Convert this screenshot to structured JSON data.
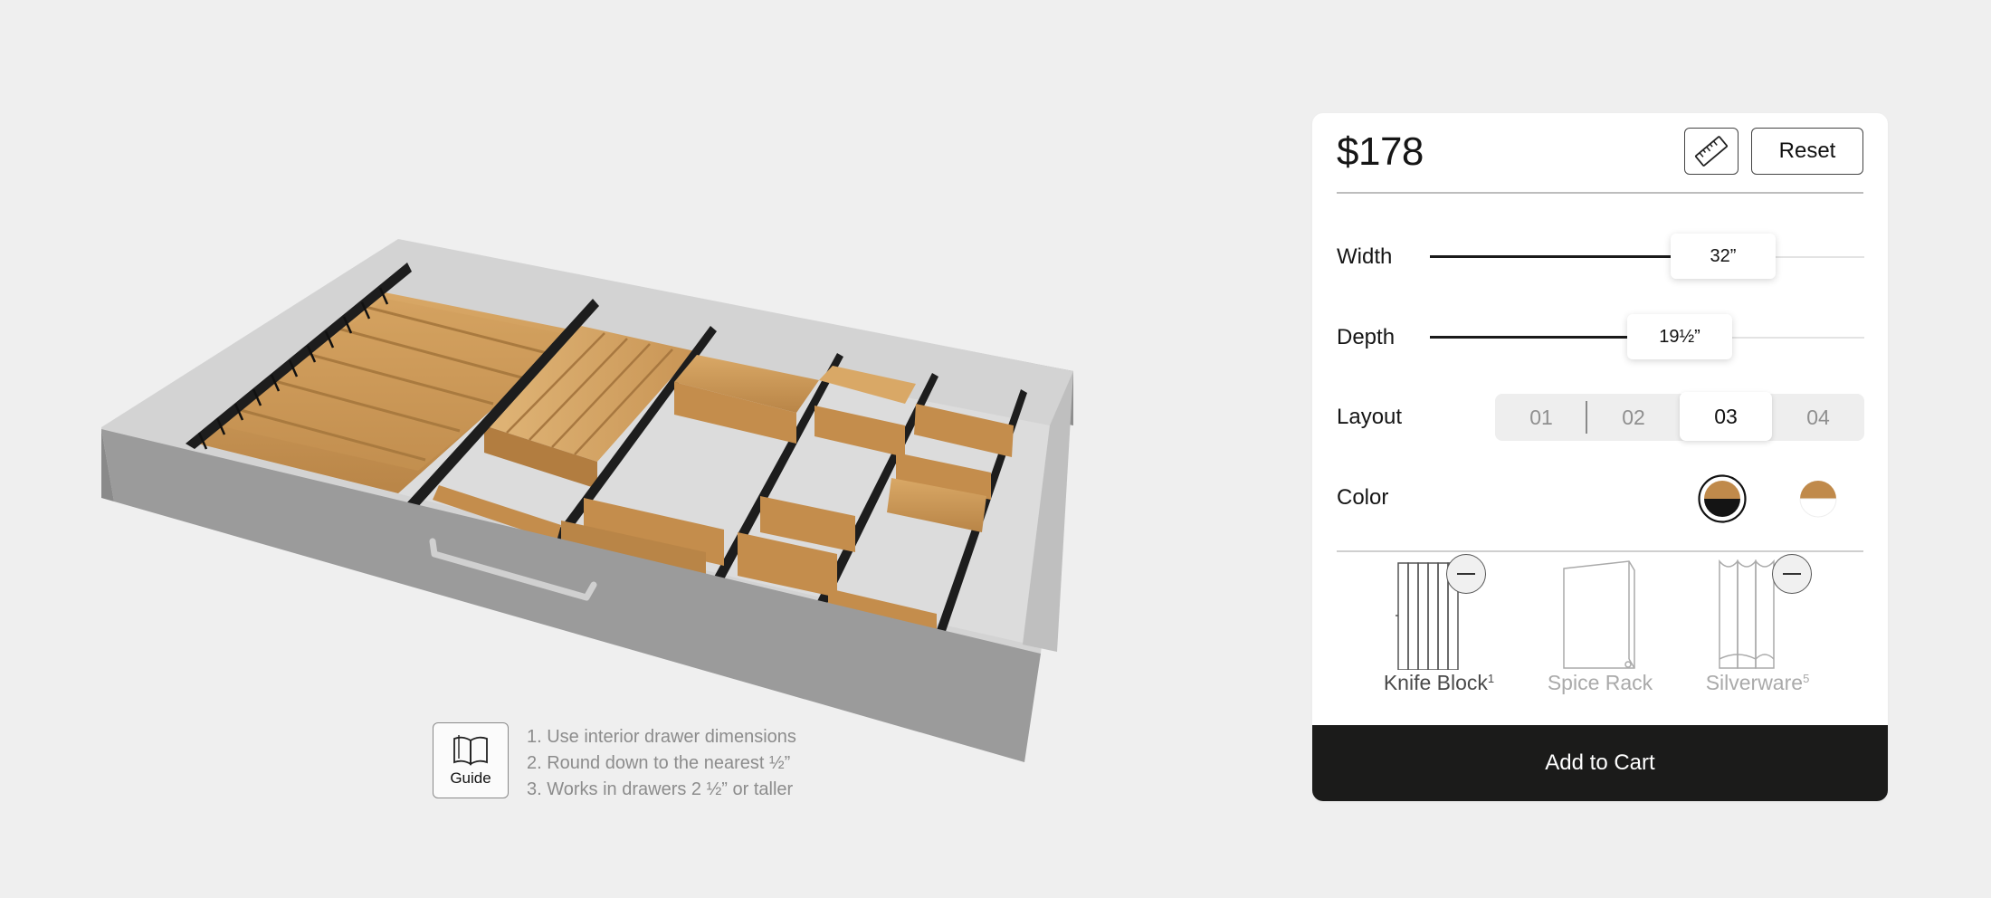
{
  "guide": {
    "label": "Guide",
    "steps": [
      "1. Use interior drawer dimensions",
      "2. Round down to the nearest ½”",
      "3. Works in drawers 2 ½” or taller"
    ]
  },
  "panel": {
    "price": "$178",
    "reset_label": "Reset",
    "width": {
      "label": "Width",
      "value_text": "32”",
      "level": 0.6
    },
    "depth": {
      "label": "Depth",
      "value_text": "19½”",
      "level": 0.5
    },
    "layout": {
      "label": "Layout",
      "options": [
        "01",
        "02",
        "03",
        "04"
      ],
      "selected": "03"
    },
    "color": {
      "label": "Color",
      "options": [
        "walnut-black",
        "bamboo-white"
      ],
      "selected": "walnut-black"
    },
    "accessories": [
      {
        "name": "Knife Block",
        "sup": "1",
        "added": true
      },
      {
        "name": "Spice Rack",
        "sup": "",
        "added": false
      },
      {
        "name": "Silverware",
        "sup": "5",
        "added": true
      }
    ],
    "add_to_cart_label": "Add to Cart"
  },
  "colors": {
    "cart_bg": "#1b1b1a",
    "bamboo": "#c8934f",
    "drawer_gray": "#9b9b9b",
    "background": "#efefef"
  },
  "icons": {
    "measure": "ruler-icon",
    "guide": "open-book-icon",
    "remove": "minus-icon"
  }
}
